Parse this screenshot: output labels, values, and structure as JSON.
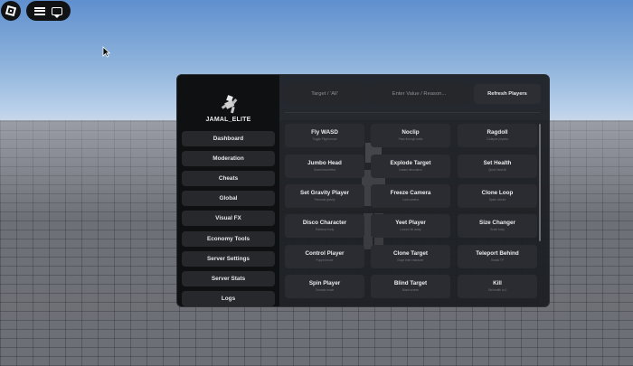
{
  "user": {
    "name": "JAMAL_ELITE"
  },
  "sidebar": {
    "items": [
      {
        "label": "Dashboard"
      },
      {
        "label": "Moderation"
      },
      {
        "label": "Cheats"
      },
      {
        "label": "Global"
      },
      {
        "label": "Visual FX"
      },
      {
        "label": "Economy Tools"
      },
      {
        "label": "Server Settings"
      },
      {
        "label": "Server Stats"
      },
      {
        "label": "Logs"
      }
    ]
  },
  "top": {
    "target_label": "Target / 'All'",
    "value_placeholder": "Enter Value / Reason...",
    "refresh_label": "Refresh Players"
  },
  "commands": [
    {
      "title": "Fly WASD",
      "sub": "Toggle Flight mode"
    },
    {
      "title": "Noclip",
      "sub": "Pass through walls"
    },
    {
      "title": "Ragdoll",
      "sub": "Collapse physics"
    },
    {
      "title": "Jumbo Head",
      "sub": "Giant head effect"
    },
    {
      "title": "Explode Target",
      "sub": "Instant detonation"
    },
    {
      "title": "Set Health",
      "sub": "Quick Heal All"
    },
    {
      "title": "Set Gravity Player",
      "sub": "Personal gravity"
    },
    {
      "title": "Freeze Camera",
      "sub": "Lock camera"
    },
    {
      "title": "Clone Loop",
      "sub": "Spam clones"
    },
    {
      "title": "Disco Character",
      "sub": "Rainbow body"
    },
    {
      "title": "Yeet Player",
      "sub": "Launch far away"
    },
    {
      "title": "Size Changer",
      "sub": "Scale body"
    },
    {
      "title": "Control Player",
      "sub": "Puppet mode"
    },
    {
      "title": "Clone Target",
      "sub": "Dupe their character"
    },
    {
      "title": "Teleport Behind",
      "sub": "Sneak TP"
    },
    {
      "title": "Spin Player",
      "sub": "Tornado mode"
    },
    {
      "title": "Blind Target",
      "sub": "Black screen"
    },
    {
      "title": "Kill",
      "sub": "Set health to 0"
    }
  ],
  "icons": {
    "roblox": "roblox-logo-icon",
    "menu": "hamburger-icon",
    "chat": "chat-icon",
    "cursor": "mouse-cursor-icon",
    "avatar": "avatar-icon"
  }
}
